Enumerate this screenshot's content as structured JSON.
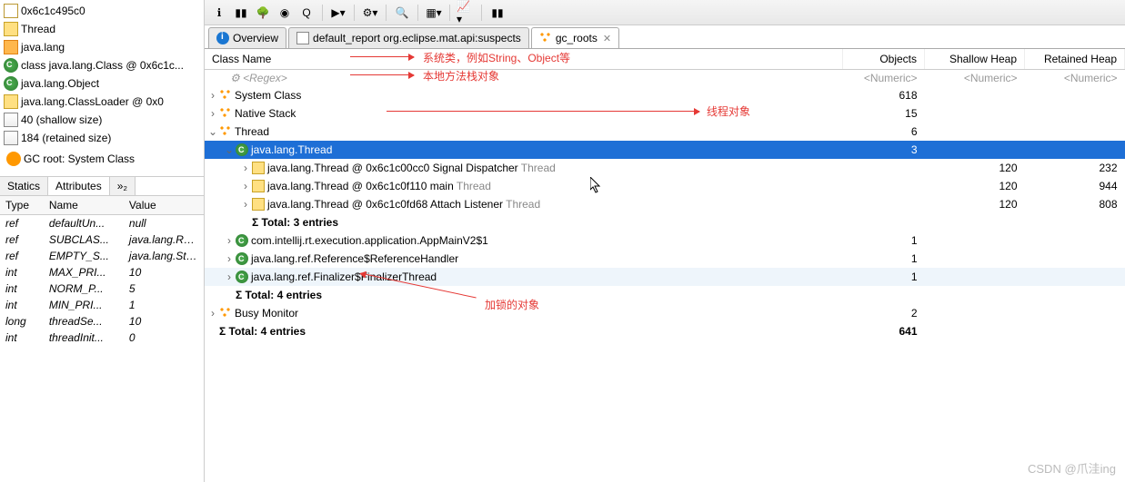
{
  "left_tree": {
    "nodes": [
      {
        "icon": "addr",
        "label": "0x6c1c495c0"
      },
      {
        "icon": "obj",
        "label": "Thread"
      },
      {
        "icon": "pkg",
        "label": "java.lang"
      },
      {
        "icon": "class",
        "label": "class java.lang.Class @ 0x6c1c..."
      },
      {
        "icon": "class",
        "label": "java.lang.Object"
      },
      {
        "icon": "obj",
        "label": "java.lang.ClassLoader @ 0x0"
      },
      {
        "icon": "ruler",
        "label": "40 (shallow size)"
      },
      {
        "icon": "ruler",
        "label": "184 (retained size)"
      },
      {
        "icon": "dot",
        "label": "GC root: System Class"
      }
    ]
  },
  "mini_tabs": {
    "tab1": "Statics",
    "tab2": "Attributes",
    "overflow": "»₂"
  },
  "attr_headers": {
    "c1": "Type",
    "c2": "Name",
    "c3": "Value"
  },
  "attrs": [
    {
      "t": "ref",
      "n": "defaultUn...",
      "v": "null"
    },
    {
      "t": "ref",
      "n": "SUBCLAS...",
      "v": "java.lang.Run..."
    },
    {
      "t": "ref",
      "n": "EMPTY_S...",
      "v": "java.lang.Stac..."
    },
    {
      "t": "int",
      "n": "MAX_PRI...",
      "v": "10"
    },
    {
      "t": "int",
      "n": "NORM_P...",
      "v": "5"
    },
    {
      "t": "int",
      "n": "MIN_PRI...",
      "v": "1"
    },
    {
      "t": "long",
      "n": "threadSe...",
      "v": "10"
    },
    {
      "t": "int",
      "n": "threadInit...",
      "v": "0"
    }
  ],
  "editor_tabs": [
    {
      "icon": "info",
      "label": "Overview",
      "active": false
    },
    {
      "icon": "report",
      "label": "default_report  org.eclipse.mat.api:suspects",
      "active": false
    },
    {
      "icon": "gc",
      "label": "gc_roots",
      "active": true,
      "close": true
    }
  ],
  "main_headers": {
    "c1": "Class Name",
    "c2": "Objects",
    "c3": "Shallow Heap",
    "c4": "Retained Heap"
  },
  "regex_row": {
    "label": "<Regex>",
    "ph": "<Numeric>"
  },
  "rows": [
    {
      "ind": 0,
      "exp": ">",
      "icon": "gc",
      "name": "System Class",
      "obj": "618",
      "sh": "",
      "rh": "",
      "cls": ""
    },
    {
      "ind": 0,
      "exp": ">",
      "icon": "gc",
      "name": "Native Stack",
      "obj": "15",
      "sh": "",
      "rh": "",
      "cls": ""
    },
    {
      "ind": 0,
      "exp": "v",
      "icon": "gc",
      "name": "Thread",
      "obj": "6",
      "sh": "",
      "rh": "",
      "cls": ""
    },
    {
      "ind": 1,
      "exp": "v",
      "icon": "class",
      "name": "java.lang.Thread",
      "obj": "3",
      "sh": "",
      "rh": "",
      "cls": "sel"
    },
    {
      "ind": 2,
      "exp": ">",
      "icon": "obj",
      "name": "java.lang.Thread @ 0x6c1c00cc0  Signal Dispatcher ",
      "suffix": "Thread",
      "obj": "",
      "sh": "120",
      "rh": "232",
      "cls": ""
    },
    {
      "ind": 2,
      "exp": ">",
      "icon": "obj",
      "name": "java.lang.Thread @ 0x6c1c0f110  main ",
      "suffix": "Thread",
      "obj": "",
      "sh": "120",
      "rh": "944",
      "cls": ""
    },
    {
      "ind": 2,
      "exp": ">",
      "icon": "obj",
      "name": "java.lang.Thread @ 0x6c1c0fd68  Attach Listener ",
      "suffix": "Thread",
      "obj": "",
      "sh": "120",
      "rh": "808",
      "cls": ""
    },
    {
      "ind": 2,
      "exp": "",
      "icon": "",
      "name": "Σ  Total: 3 entries",
      "obj": "",
      "sh": "",
      "rh": "",
      "cls": "",
      "bold": true
    },
    {
      "ind": 1,
      "exp": ">",
      "icon": "class",
      "name": "com.intellij.rt.execution.application.AppMainV2$1",
      "obj": "1",
      "sh": "",
      "rh": "",
      "cls": ""
    },
    {
      "ind": 1,
      "exp": ">",
      "icon": "class",
      "name": "java.lang.ref.Reference$ReferenceHandler",
      "obj": "1",
      "sh": "",
      "rh": "",
      "cls": ""
    },
    {
      "ind": 1,
      "exp": ">",
      "icon": "class",
      "name": "java.lang.ref.Finalizer$FinalizerThread",
      "obj": "1",
      "sh": "",
      "rh": "",
      "cls": "alt"
    },
    {
      "ind": 1,
      "exp": "",
      "icon": "",
      "name": "Σ  Total: 4 entries",
      "obj": "",
      "sh": "",
      "rh": "",
      "cls": "",
      "bold": true
    },
    {
      "ind": 0,
      "exp": ">",
      "icon": "gc",
      "name": "Busy Monitor",
      "obj": "2",
      "sh": "",
      "rh": "",
      "cls": ""
    },
    {
      "ind": 0,
      "exp": "",
      "icon": "",
      "name": "Σ  Total: 4 entries",
      "obj": "641",
      "sh": "",
      "rh": "",
      "cls": "",
      "bold": true
    }
  ],
  "annotations": {
    "a1": "系统类，例如String、Object等",
    "a2": "本地方法栈对象",
    "a3": "线程对象",
    "a4": "加锁的对象"
  },
  "watermark": "CSDN @爪洼ing"
}
